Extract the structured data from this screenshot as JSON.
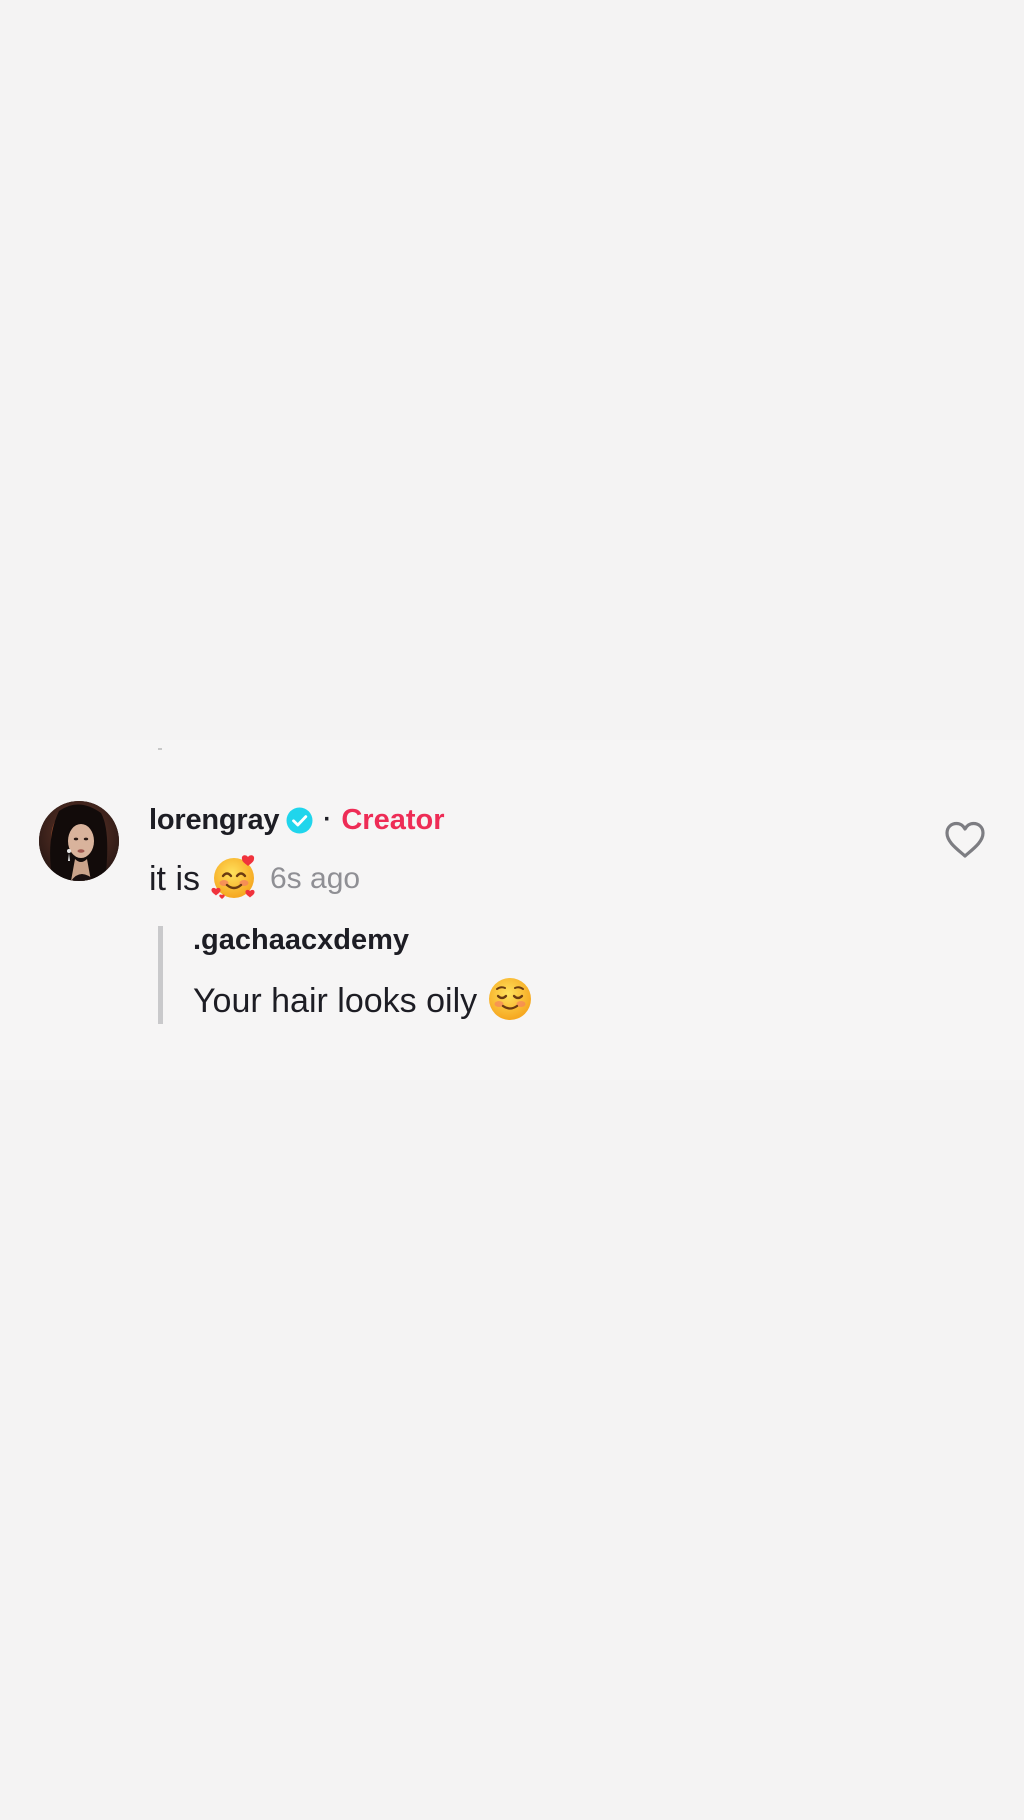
{
  "comment": {
    "avatar_icon": "avatar-photo",
    "username": "lorengray",
    "verified_icon": "verified-check-icon",
    "separator": "·",
    "role_badge": "Creator",
    "text": "it is",
    "emoji": "🥰",
    "timestamp": "6s ago",
    "like_icon": "heart-outline-icon"
  },
  "reply_to": {
    "username": ".gachaacxdemy",
    "text": "Your hair looks oily",
    "emoji": "☺️"
  },
  "colors": {
    "background": "#f4f3f3",
    "text_primary": "#1d1d24",
    "creator_accent": "#ee2c56",
    "verified_blue": "#20d5ec",
    "muted": "#8f8f94",
    "quote_bar": "#c9c9cb"
  }
}
